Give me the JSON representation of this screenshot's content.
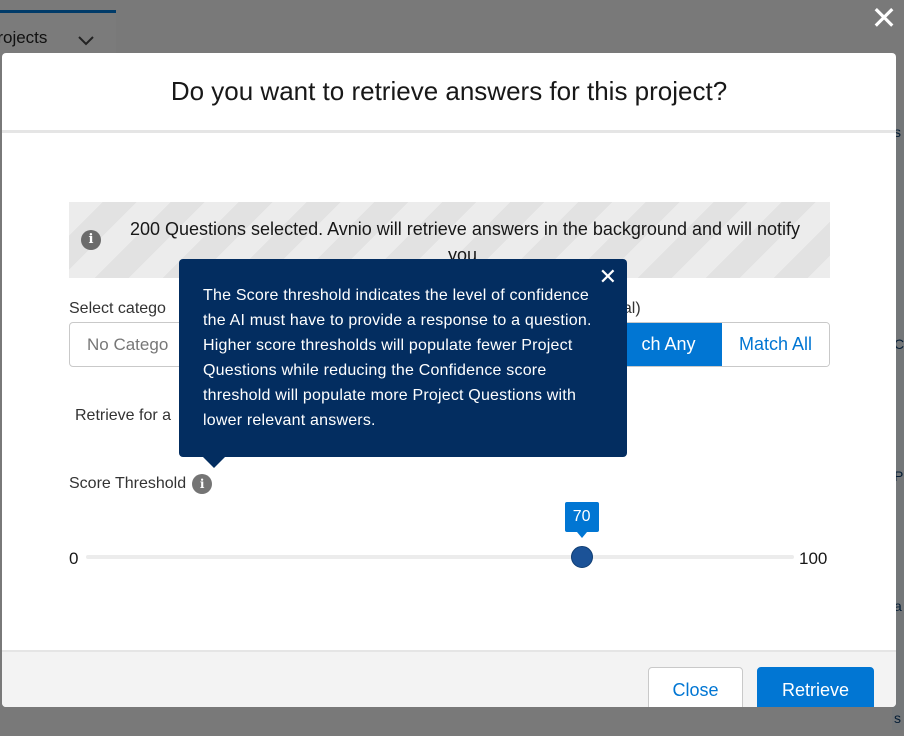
{
  "background": {
    "tab_label": "Projects",
    "right_strip_chars": [
      "s",
      "C",
      "P",
      "a",
      "s"
    ]
  },
  "modal": {
    "title": "Do you want to retrieve answers for this project?",
    "notice": "200 Questions selected. Avnio will retrieve answers in the background and will notify you.",
    "category_label": "Select catego",
    "category_placeholder": "No Catego",
    "optional_label": "nal)",
    "match_any_label": "ch Any",
    "match_all_label": "Match All",
    "retrieve_for_label": "Retrieve for a",
    "score_label": "Score Threshold",
    "slider": {
      "min_label": "0",
      "max_label": "100",
      "value": 70,
      "min": 0,
      "max": 100
    },
    "footer": {
      "close_label": "Close",
      "retrieve_label": "Retrieve"
    }
  },
  "tooltip": {
    "close_glyph": "✕",
    "text": "The Score threshold indicates the level of confidence the AI must have to provide a response to a question. Higher score thresholds will populate fewer Project Questions while reducing the Confidence score threshold will populate more Project Questions with lower relevant answers."
  },
  "icons": {
    "window_close": "✕",
    "chevron": "⌄",
    "info": "i"
  },
  "colors": {
    "brand_blue": "#0176d3",
    "tooltip_bg": "#032d60",
    "slider_thumb": "#1b5297"
  }
}
